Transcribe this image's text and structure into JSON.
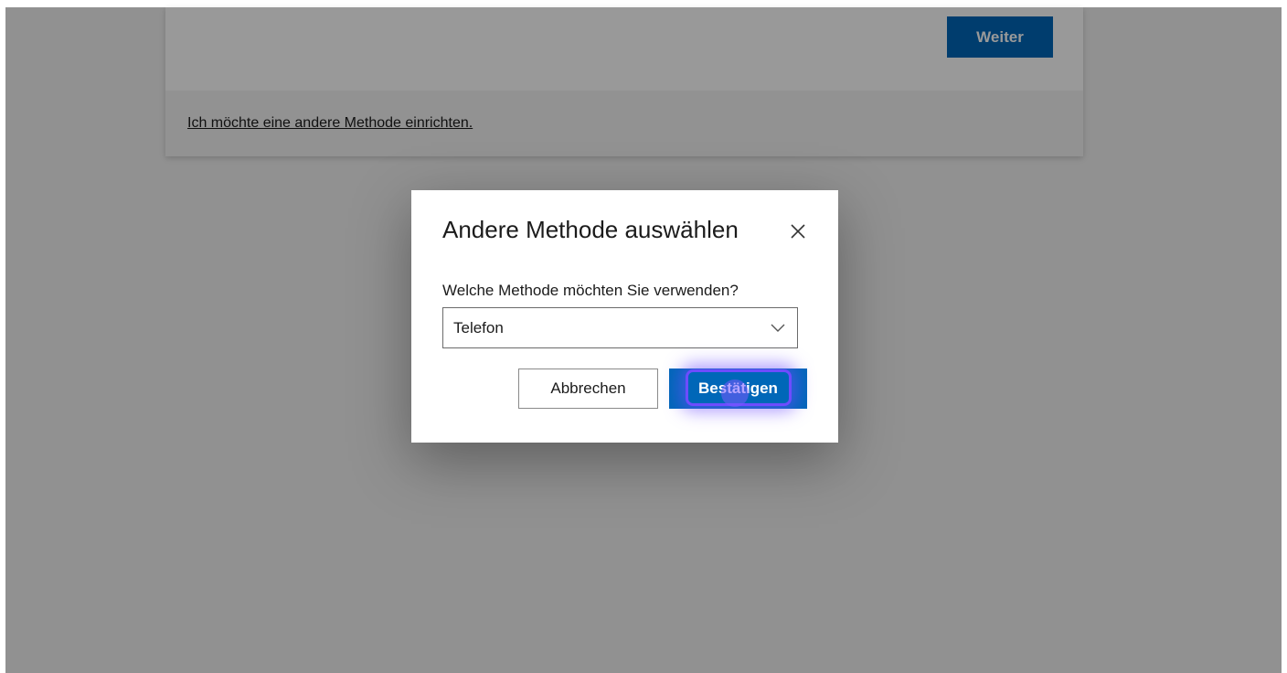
{
  "page": {
    "next_button_label": "Weiter",
    "other_method_link": "Ich möchte eine andere Methode einrichten."
  },
  "dialog": {
    "title": "Andere Methode auswählen",
    "question": "Welche Methode möchten Sie verwenden?",
    "select_value": "Telefon",
    "cancel_label": "Abbrechen",
    "confirm_label": "Bestätigen"
  },
  "icons": {
    "close": "close-icon",
    "dropdown": "chevron-down-icon"
  },
  "colors": {
    "primary": "#0067b8",
    "overlay": "rgba(0,0,0,0.40)",
    "focus": "#6e4cff"
  }
}
